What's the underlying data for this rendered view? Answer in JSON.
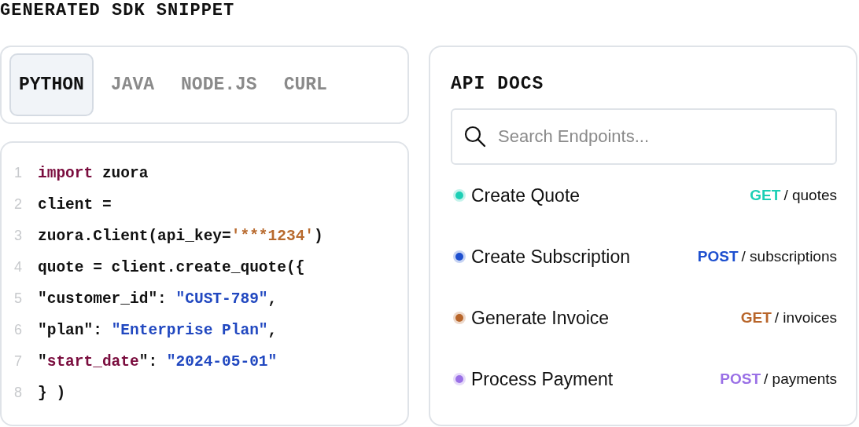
{
  "heading": "GENERATED SDK SNIPPET",
  "tabs": [
    {
      "label": "PYTHON",
      "selected": true
    },
    {
      "label": "JAVA",
      "selected": false
    },
    {
      "label": "NODE.JS",
      "selected": false
    },
    {
      "label": "CURL",
      "selected": false
    }
  ],
  "code": {
    "lines": [
      {
        "number": "1",
        "tokens": [
          {
            "kind": "keyword",
            "text": "import"
          },
          {
            "kind": "plain",
            "text": " zuora"
          }
        ]
      },
      {
        "number": "2",
        "tokens": [
          {
            "kind": "plain",
            "text": "client ="
          }
        ]
      },
      {
        "number": "3",
        "tokens": [
          {
            "kind": "plain",
            "text": "zuora.Client(api_key="
          },
          {
            "kind": "secret",
            "text": "'***1234'"
          },
          {
            "kind": "plain",
            "text": ")"
          }
        ]
      },
      {
        "number": "4",
        "tokens": [
          {
            "kind": "plain",
            "text": "quote = client.create_quote({"
          }
        ]
      },
      {
        "number": "5",
        "tokens": [
          {
            "kind": "plain",
            "text": "\"customer_id\": "
          },
          {
            "kind": "string",
            "text": "\"CUST-789\""
          },
          {
            "kind": "plain",
            "text": ","
          }
        ]
      },
      {
        "number": "6",
        "tokens": [
          {
            "kind": "plain",
            "text": "\"plan\": "
          },
          {
            "kind": "string",
            "text": "\"Enterprise Plan\""
          },
          {
            "kind": "plain",
            "text": ","
          }
        ]
      },
      {
        "number": "7",
        "tokens": [
          {
            "kind": "plain",
            "text": "\""
          },
          {
            "kind": "keyword",
            "text": "start_date"
          },
          {
            "kind": "plain",
            "text": "\": "
          },
          {
            "kind": "string",
            "text": "\"2024-05-01\""
          }
        ]
      },
      {
        "number": "8",
        "tokens": [
          {
            "kind": "plain",
            "text": "} )"
          }
        ]
      }
    ]
  },
  "api_docs": {
    "title": "API DOCS",
    "search": {
      "placeholder": "Search Endpoints..."
    },
    "endpoints": [
      {
        "name": "Create Quote",
        "method": "GET",
        "path": "/ quotes",
        "color": "#1ccfb5"
      },
      {
        "name": "Create Subscription",
        "method": "POST",
        "path": "/ subscriptions",
        "color": "#1d4fcf"
      },
      {
        "name": "Generate Invoice",
        "method": "GET",
        "path": "/ invoices",
        "color": "#b8652a"
      },
      {
        "name": "Process Payment",
        "method": "POST",
        "path": "/ payments",
        "color": "#9a70e6"
      }
    ]
  }
}
